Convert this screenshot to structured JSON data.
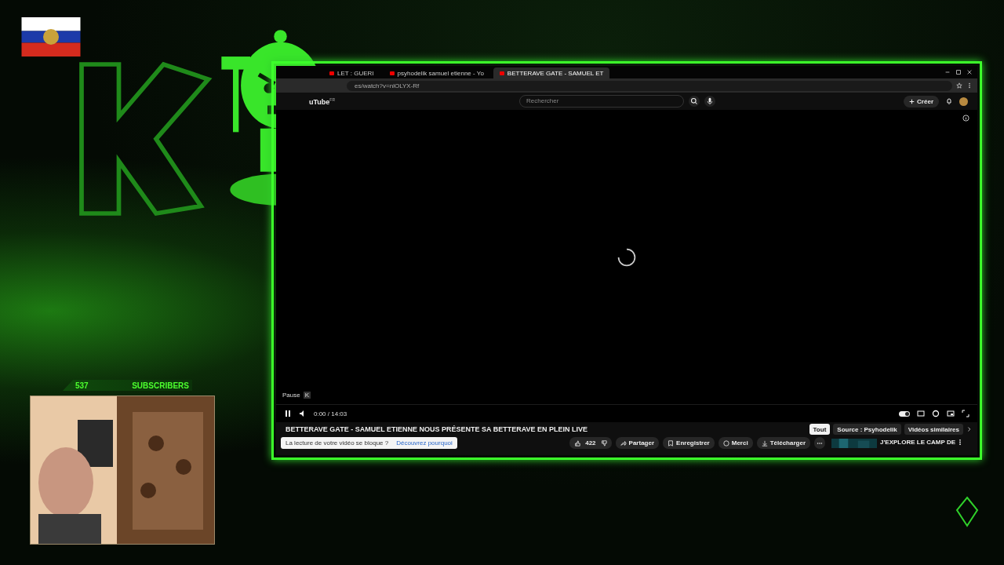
{
  "overlay": {
    "subscriber_count": "537",
    "subscriber_label": "SUBSCRIBERS"
  },
  "browser": {
    "tabs": [
      {
        "title": "LET : GUERI",
        "selected": false
      },
      {
        "title": "psyhodelik samuel etienne - Yo",
        "selected": false
      },
      {
        "title": "BETTERAVE GATE - SAMUEL ET",
        "selected": true
      }
    ],
    "address": "es/watch?v=nlOLYX-Rf"
  },
  "youtube": {
    "logo": "uTube",
    "country": "FR",
    "search_placeholder": "Rechercher",
    "create_label": "Créer",
    "tooltip": {
      "label": "Pause",
      "key": "K"
    },
    "time": "0:00 / 14:03",
    "autoplay_on": true,
    "title": "BETTERAVE GATE - SAMUEL ETIENNE NOUS PRÉSENTE SA BETTERAVE EN PLEIN LIVE",
    "notice": {
      "text": "La lecture de votre vidéo se bloque ?",
      "link": "Découvrez pourquoi"
    },
    "likes": "422",
    "actions": [
      {
        "kind": "share",
        "label": "Partager"
      },
      {
        "kind": "save",
        "label": "Enregistrer"
      },
      {
        "kind": "thanks",
        "label": "Merci"
      },
      {
        "kind": "download",
        "label": "Télécharger"
      }
    ],
    "chips": [
      {
        "label": "Tout",
        "selected": true
      },
      {
        "label": "Source : Psyhodelik",
        "selected": false
      },
      {
        "label": "Vidéos similaires",
        "selected": false
      }
    ],
    "suggested_title": "J'EXPLORE LE CAMP DE"
  }
}
